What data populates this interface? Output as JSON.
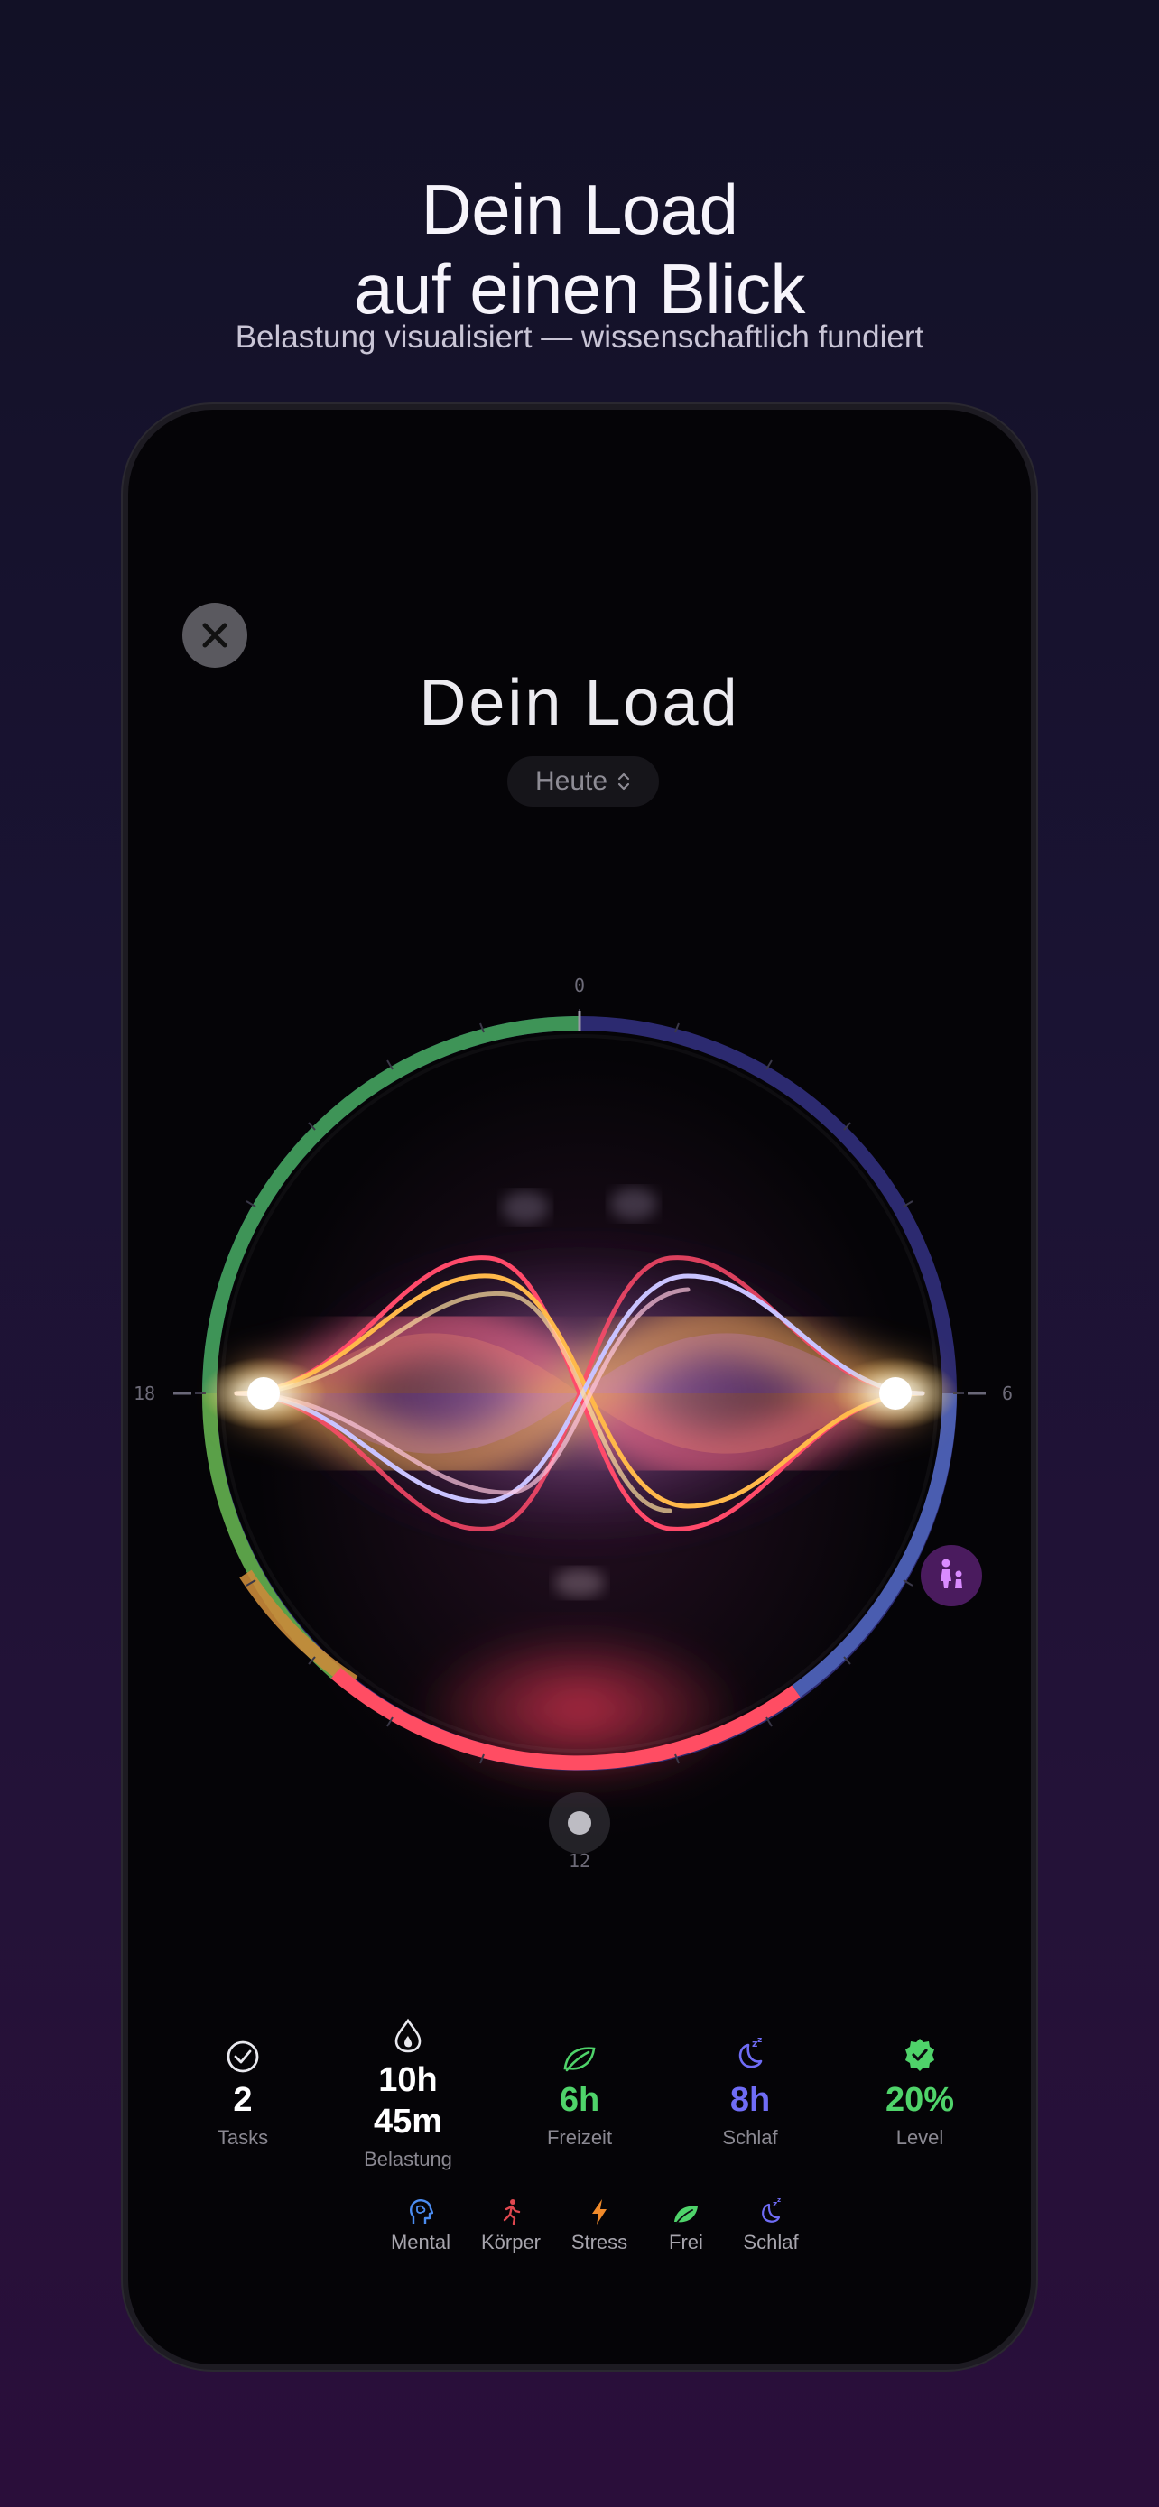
{
  "hero": {
    "title": "Dein Load\nauf einen Blick",
    "subtitle": "Belastung visualisiert — wissenschaftlich fundiert"
  },
  "app": {
    "title": "Dein Load",
    "range_selector": {
      "selected": "Heute",
      "icon": "chevron-up-down-icon"
    },
    "close_icon": "close-icon",
    "dial": {
      "hour_labels": {
        "top": "0",
        "right": "6",
        "bottom": "12",
        "left": "18"
      },
      "activity_badge_icon": "walking-family-icon",
      "colors": {
        "ring_green": "#3f9a55",
        "ring_blue": "#3a3a9a",
        "ring_red": "#ff4d63",
        "wave_red": "#ff4a6a",
        "wave_yellow": "#ffb84a",
        "wave_lavender": "#c9c3ff"
      }
    },
    "stats": [
      {
        "icon": "checkmark-circle-icon",
        "value": "2",
        "label": "Tasks",
        "color": "#ffffff"
      },
      {
        "icon": "flame-drop-icon",
        "value": "10h\n45m",
        "label": "Belastung",
        "color": "#ffffff"
      },
      {
        "icon": "leaf-icon",
        "value": "6h",
        "label": "Freizeit",
        "color": "#4fd36a"
      },
      {
        "icon": "moon-zzz-icon",
        "value": "8h",
        "label": "Schlaf",
        "color": "#6f6cf5"
      },
      {
        "icon": "verified-badge-icon",
        "value": "20%",
        "label": "Level",
        "color": "#4fd36a"
      }
    ],
    "legend": [
      {
        "icon": "brain-head-icon",
        "label": "Mental",
        "color": "#4b8cf0"
      },
      {
        "icon": "running-figure-icon",
        "label": "Körper",
        "color": "#e0474f"
      },
      {
        "icon": "lightning-icon",
        "label": "Stress",
        "color": "#f08a2a"
      },
      {
        "icon": "leaf-icon",
        "label": "Frei",
        "color": "#4fd36a"
      },
      {
        "icon": "moon-zzz-icon",
        "label": "Schlaf",
        "color": "#6f6cf5"
      }
    ]
  }
}
